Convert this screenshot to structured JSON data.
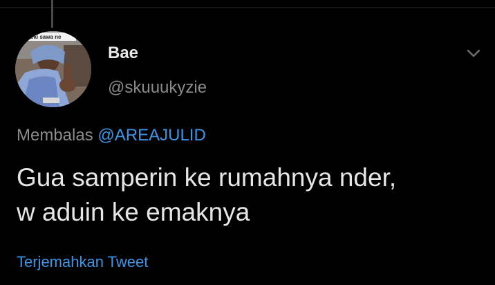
{
  "tweet": {
    "display_name": "Bae",
    "handle": "@skuuukyzie",
    "reply_prefix": "Membalas",
    "reply_mention": "@AREAJULID",
    "text_lines": [
      "Gua samperin ke rumahnya nder,",
      "w aduin ke emaknya"
    ],
    "translate_label": "Terjemahkan Tweet"
  },
  "avatar": {
    "overlay_text": "eki sawa ne"
  },
  "icons": {
    "more": "chevron-down-icon"
  },
  "colors": {
    "background": "#000000",
    "text": "#e6e6e6",
    "secondary": "#8b8b8b",
    "link": "#3b96e8"
  }
}
